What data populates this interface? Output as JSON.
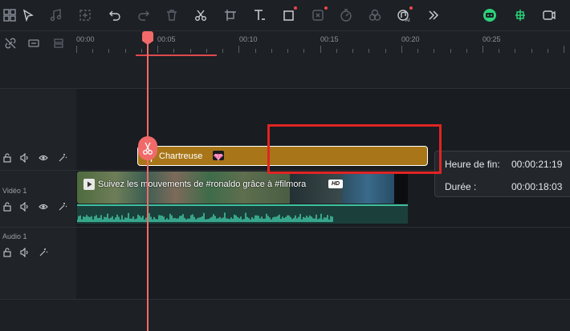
{
  "ruler": {
    "ticks": [
      "00:00",
      "00:05",
      "00:10",
      "00:15",
      "00:20",
      "00:25"
    ]
  },
  "tracks": {
    "video_label": "Vidéo 1",
    "audio_label": "Audio 1"
  },
  "text_clip": {
    "label": "Chartreuse"
  },
  "video_clip": {
    "title": "Suivez les mouvements de #ronaldo grâce à #filmora",
    "badge": "HD"
  },
  "tooltip": {
    "end_label": "Heure de fin:",
    "end_value": "00:00:21:19",
    "duration_label": "Durée :",
    "duration_value": "00:00:18:03"
  },
  "colors": {
    "accent": "#f06a6a",
    "text_clip": "#a87618",
    "audio_wave": "#3fc1a0",
    "highlight": "#e02424",
    "ai_green": "#2bd37a"
  },
  "icons": [
    "select-arrow-icon",
    "audio-icon",
    "crop-icon",
    "undo-icon",
    "redo-icon",
    "delete-icon",
    "scissors-icon",
    "transform-icon",
    "text-icon",
    "shape-icon",
    "freeze-icon",
    "speed-icon",
    "color-icon",
    "ai-audio-icon",
    "more-icon",
    "ai-mate-icon",
    "snap-icon",
    "record-icon"
  ]
}
